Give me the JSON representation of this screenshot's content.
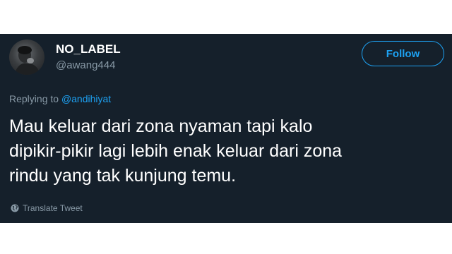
{
  "tweet": {
    "display_name": "NO_LABEL",
    "handle": "@awang444",
    "follow_label": "Follow",
    "reply_prefix": "Replying to",
    "reply_mention": "@andihiyat",
    "text_lines": [
      "Mau keluar dari zona nyaman tapi kalo",
      "dipikir-pikir lagi lebih enak keluar dari zona",
      "rindu yang tak kunjung temu."
    ],
    "translate_label": "Translate Tweet",
    "avatar_icon": "user-photo",
    "translate_icon": "globe-icon"
  },
  "colors": {
    "background": "#15202b",
    "accent": "#1da1f2",
    "secondary_text": "#8899a6",
    "primary_text": "#ffffff"
  }
}
